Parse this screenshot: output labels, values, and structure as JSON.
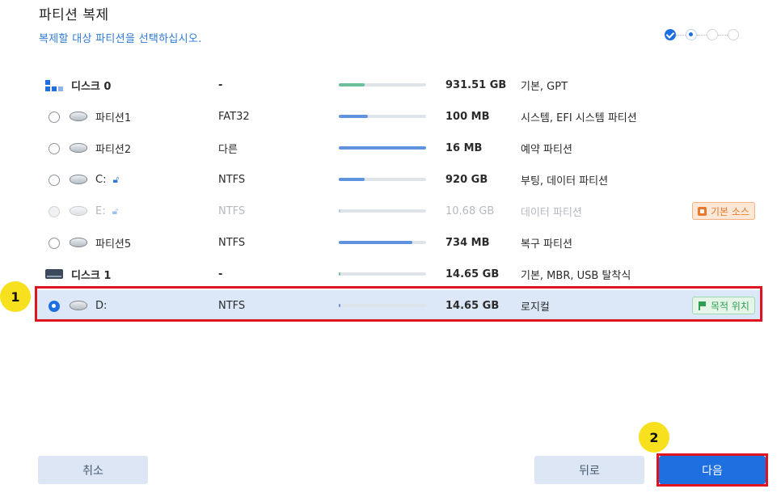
{
  "header": {
    "title": "파티션 복제",
    "subtitle": "복제할 대상 파티션을 선택하십시오."
  },
  "steps": [
    "done",
    "current",
    "todo",
    "todo"
  ],
  "rows": [
    {
      "kind": "disk",
      "icon": "disk-blocks-icon",
      "name": "디스크 0",
      "fs": "-",
      "usage": 0.3,
      "size": "931.51 GB",
      "type": "기본, GPT"
    },
    {
      "kind": "partition",
      "name": "파티션1",
      "fs": "FAT32",
      "usage": 0.33,
      "size": "100 MB",
      "type": "시스템, EFI 시스템 파티션"
    },
    {
      "kind": "partition",
      "name": "파티션2",
      "fs": "다른",
      "usage": 1.0,
      "size": "16 MB",
      "type": "예약 파티션"
    },
    {
      "kind": "partition",
      "name": "C:",
      "lock": true,
      "fs": "NTFS",
      "usage": 0.3,
      "size": "920 GB",
      "type": "부팅, 데이터 파티션"
    },
    {
      "kind": "partition",
      "disabled": true,
      "name": "E:",
      "lock": true,
      "fs": "NTFS",
      "usage": 0.01,
      "size": "10.68 GB",
      "type": "데이터 파티션",
      "badge": {
        "kind": "source",
        "label": "기본 소스"
      }
    },
    {
      "kind": "partition",
      "name": "파티션5",
      "fs": "NTFS",
      "usage": 0.84,
      "size": "734 MB",
      "type": "복구 파티션"
    },
    {
      "kind": "disk",
      "icon": "disk-drive-icon",
      "name": "디스크 1",
      "fs": "-",
      "usage": 0.01,
      "size": "14.65 GB",
      "type": "기본, MBR, USB 탈착식"
    },
    {
      "kind": "partition",
      "selected": true,
      "name": "D:",
      "fs": "NTFS",
      "usage": 0.01,
      "size": "14.65 GB",
      "type": "로지컬",
      "badge": {
        "kind": "target",
        "label": "목적 위치"
      }
    }
  ],
  "markers": {
    "one": "1",
    "two": "2"
  },
  "buttons": {
    "cancel": "취소",
    "back": "뒤로",
    "next": "다음"
  }
}
